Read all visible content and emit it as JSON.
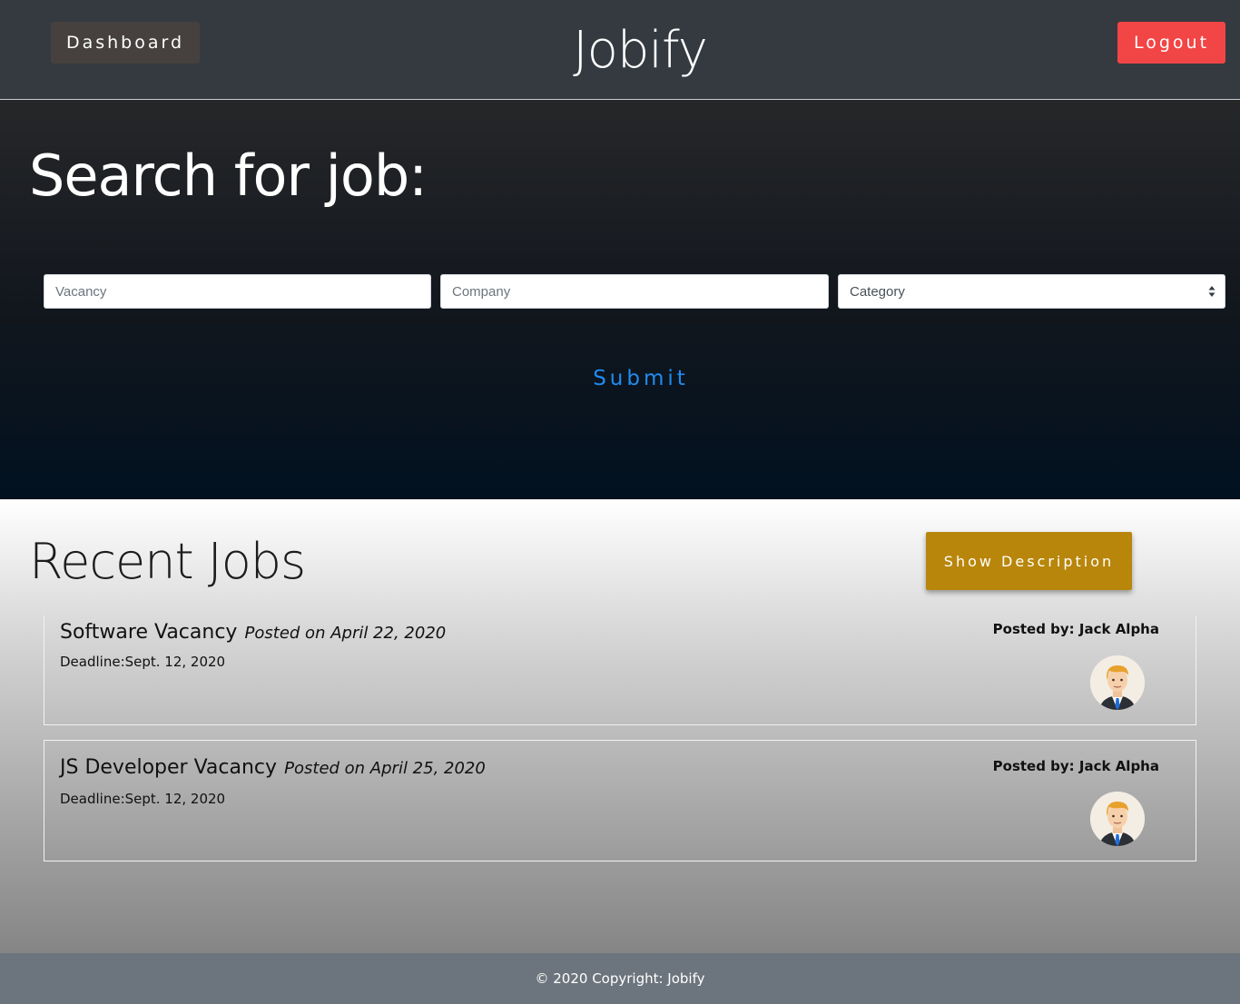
{
  "header": {
    "dashboard_label": "Dashboard",
    "brand": "Jobify",
    "logout_label": "Logout"
  },
  "search": {
    "title": "Search for job:",
    "vacancy_placeholder": "Vacancy",
    "company_placeholder": "Company",
    "category_selected": "Category",
    "submit_label": "Submit"
  },
  "recent": {
    "title": "Recent Jobs",
    "show_description_label": "Show Description",
    "jobs": [
      {
        "title": "Software Vacancy",
        "posted": "Posted on April 22, 2020",
        "deadline": "Deadline:Sept. 12, 2020",
        "posted_by": "Posted by: Jack Alpha",
        "avatar_icon": "businessman-avatar-icon"
      },
      {
        "title": "JS Developer Vacancy",
        "posted": "Posted on April 25, 2020",
        "deadline": "Deadline:Sept. 12, 2020",
        "posted_by": "Posted by: Jack Alpha",
        "avatar_icon": "businessman-avatar-icon"
      }
    ]
  },
  "footer": {
    "text": "© 2020 Copyright: Jobify"
  },
  "colors": {
    "navbar": "#343a40",
    "logout": "#f24545",
    "submit_link": "#1f8cf2",
    "show_description": "#b8860b",
    "footer": "#6c757d"
  }
}
